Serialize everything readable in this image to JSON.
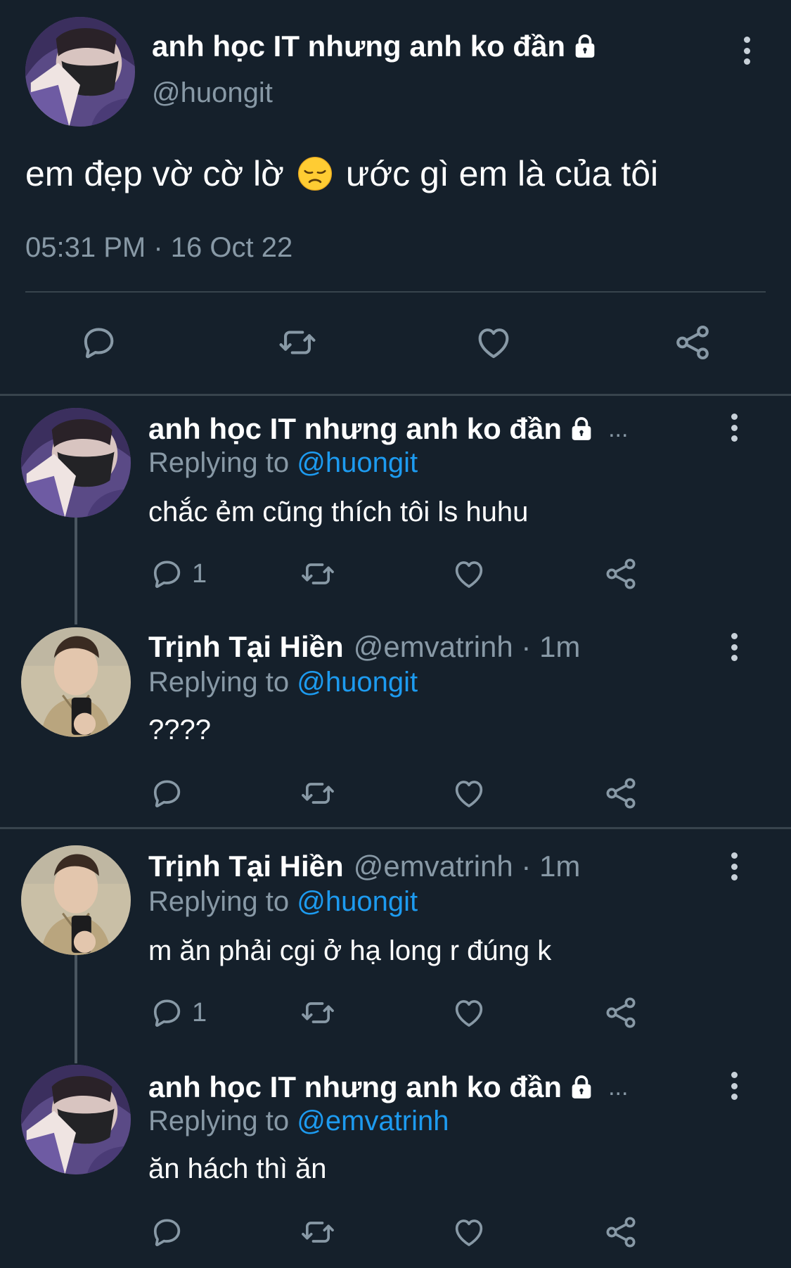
{
  "main_tweet": {
    "author_name": "anh học IT nhưng anh ko đần",
    "handle": "@huongit",
    "text_before_emoji": "em đẹp vờ cờ lờ",
    "emoji": "disappointed-face",
    "text_after_emoji": "ước gì em là của tôi",
    "timestamp": "05:31 PM · 16 Oct 22",
    "actions": [
      "reply-icon",
      "retweet-icon",
      "like-icon",
      "share-icon"
    ]
  },
  "replies": [
    {
      "author_name": "anh học IT nhưng anh ko đần",
      "ellipsis": "...",
      "replying_label": "Replying to",
      "replying_to": "@huongit",
      "text": "chắc ẻm cũng thích tôi ls huhu",
      "reply_count": "1"
    },
    {
      "author_name": "Trịnh Tại Hiền",
      "handle_meta": "@emvatrinh · 1m",
      "replying_label": "Replying to",
      "replying_to": "@huongit",
      "text": "????",
      "reply_count": ""
    },
    {
      "author_name": "Trịnh Tại Hiền",
      "handle_meta": "@emvatrinh · 1m",
      "replying_label": "Replying to",
      "replying_to": "@huongit",
      "text": "m ăn phải cgi ở hạ long r đúng k",
      "reply_count": "1"
    },
    {
      "author_name": "anh học IT nhưng anh ko đần",
      "ellipsis": "...",
      "replying_label": "Replying to",
      "replying_to": "@emvatrinh",
      "text": "ăn hách thì ăn",
      "reply_count": ""
    }
  ],
  "colors": {
    "background": "#15202b",
    "secondary_text": "#8899a6",
    "mention": "#1d9bf0",
    "divider": "#38444d"
  }
}
